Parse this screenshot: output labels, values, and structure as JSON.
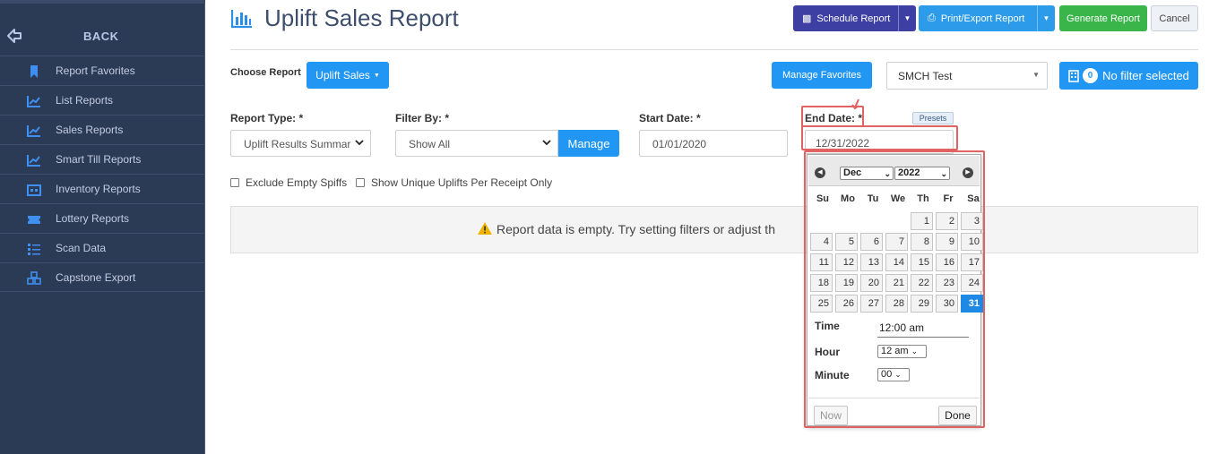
{
  "sidebar": {
    "back_label": "BACK",
    "items": [
      {
        "label": "Report Favorites",
        "icon": "bookmark-icon"
      },
      {
        "label": "List Reports",
        "icon": "line-chart-icon"
      },
      {
        "label": "Sales Reports",
        "icon": "line-chart-icon"
      },
      {
        "label": "Smart Till Reports",
        "icon": "line-chart-icon"
      },
      {
        "label": "Inventory Reports",
        "icon": "inventory-icon"
      },
      {
        "label": "Lottery Reports",
        "icon": "ticket-icon"
      },
      {
        "label": "Scan Data",
        "icon": "list-icon"
      },
      {
        "label": "Capstone Export",
        "icon": "cubes-icon"
      }
    ]
  },
  "header": {
    "title": "Uplift Sales Report",
    "schedule_label": "Schedule Report",
    "print_label": "Print/Export Report",
    "generate_label": "Generate Report",
    "cancel_label": "Cancel"
  },
  "toolbar": {
    "choose_label": "Choose Report",
    "report_button": "Uplift Sales",
    "manage_favorites": "Manage Favorites",
    "store_select": "SMCH Test",
    "filter_count": "0",
    "filter_label": "No filter selected"
  },
  "form": {
    "report_type_label": "Report Type: *",
    "report_type_value": "Uplift Results Summar",
    "filter_by_label": "Filter By: *",
    "filter_by_value": "Show All",
    "manage_label": "Manage",
    "start_date_label": "Start Date: *",
    "start_date_value": "01/01/2020",
    "end_date_label": "End Date: *",
    "end_date_value": "12/31/2022",
    "presets_label": "Presets",
    "exclude_label": "Exclude Empty Spiffs",
    "unique_label": "Show Unique Uplifts Per Receipt Only"
  },
  "notice": {
    "message": "Report data is empty. Try setting filters or adjust th"
  },
  "datepicker": {
    "month": "Dec",
    "year": "2022",
    "weekdays": [
      "Su",
      "Mo",
      "Tu",
      "We",
      "Th",
      "Fr",
      "Sa"
    ],
    "days": [
      "1",
      "2",
      "3",
      "4",
      "5",
      "6",
      "7",
      "8",
      "9",
      "10",
      "11",
      "12",
      "13",
      "14",
      "15",
      "16",
      "17",
      "18",
      "19",
      "20",
      "21",
      "22",
      "23",
      "24",
      "25",
      "26",
      "27",
      "28",
      "29",
      "30",
      "31"
    ],
    "selected_day": "31",
    "time_label": "Time",
    "time_value": "12:00 am",
    "hour_label": "Hour",
    "hour_value": "12 am",
    "minute_label": "Minute",
    "minute_value": "00",
    "now_label": "Now",
    "done_label": "Done"
  },
  "colors": {
    "sidebar_bg": "#2b3a55",
    "accent_blue": "#2196f3",
    "schedule_purple": "#3d3fa3",
    "generate_green": "#3ab54a",
    "highlight_red": "#e06363"
  }
}
